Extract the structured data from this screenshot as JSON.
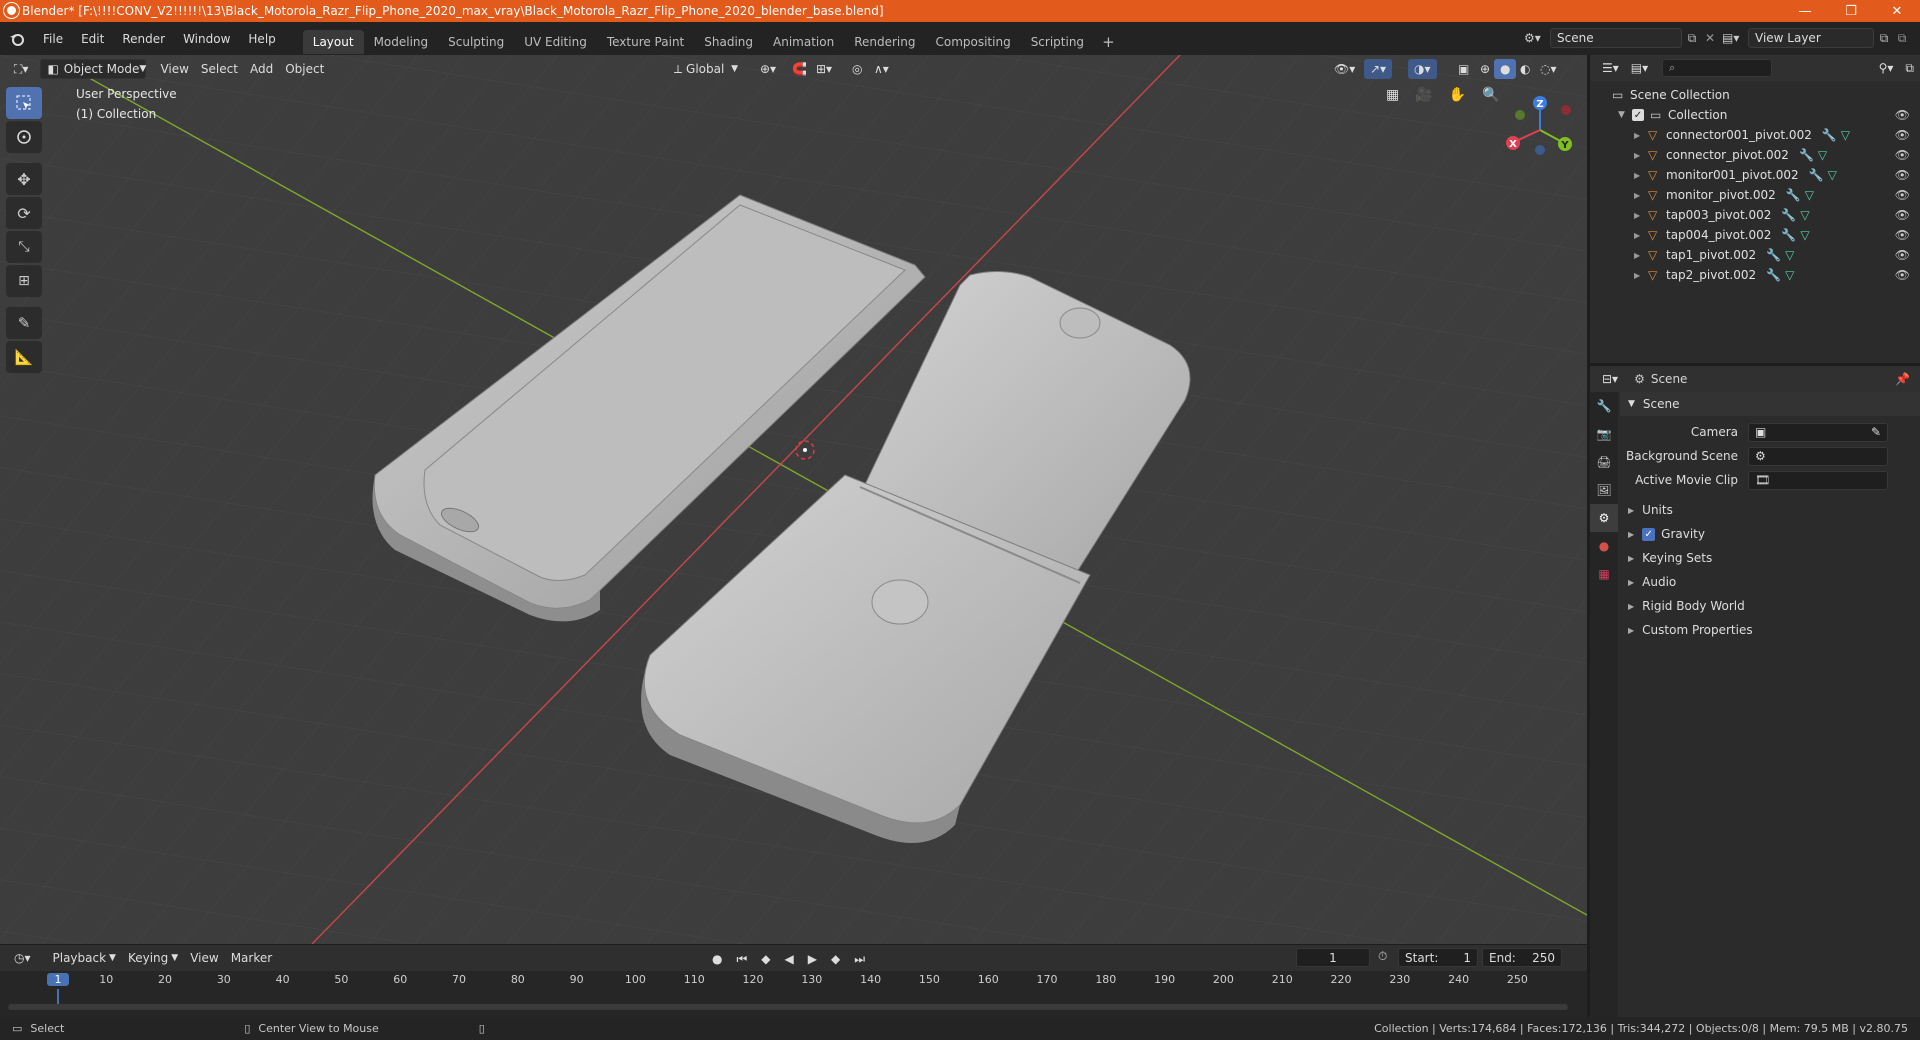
{
  "window": {
    "title": "Blender* [F:\\!!!!CONV_V2!!!!!!\\13\\Black_Motorola_Razr_Flip_Phone_2020_max_vray\\Black_Motorola_Razr_Flip_Phone_2020_blender_base.blend]",
    "minimize": "—",
    "maximize": "❐",
    "close": "✕"
  },
  "menu": {
    "items": [
      "File",
      "Edit",
      "Render",
      "Window",
      "Help"
    ],
    "workspaces": [
      "Layout",
      "Modeling",
      "Sculpting",
      "UV Editing",
      "Texture Paint",
      "Shading",
      "Animation",
      "Rendering",
      "Compositing",
      "Scripting"
    ],
    "active_workspace": "Layout",
    "add_tab": "+",
    "scene": "Scene",
    "view_layer": "View Layer"
  },
  "viewport": {
    "mode": "Object Mode",
    "menus": [
      "View",
      "Select",
      "Add",
      "Object"
    ],
    "orientation": "Global",
    "perspective_label": "User Perspective",
    "collection_label": "(1) Collection",
    "gizmo": {
      "x": "X",
      "y": "Y",
      "z": "Z"
    }
  },
  "outliner": {
    "search_placeholder": "",
    "root": "Scene Collection",
    "collection": "Collection",
    "objects": [
      "connector001_pivot.002",
      "connector_pivot.002",
      "monitor001_pivot.002",
      "monitor_pivot.002",
      "tap003_pivot.002",
      "tap004_pivot.002",
      "tap1_pivot.002",
      "tap2_pivot.002"
    ]
  },
  "properties": {
    "context": "Scene",
    "section": "Scene",
    "camera_label": "Camera",
    "background_scene_label": "Background Scene",
    "active_movie_clip_label": "Active Movie Clip",
    "panels": [
      "Units",
      "Gravity",
      "Keying Sets",
      "Audio",
      "Rigid Body World",
      "Custom Properties"
    ],
    "gravity_checked": true
  },
  "timeline": {
    "menus": [
      "Playback",
      "Keying",
      "View",
      "Marker"
    ],
    "current_frame": "1",
    "start_label": "Start:",
    "start": "1",
    "end_label": "End:",
    "end": "250",
    "ruler": [
      "1",
      "10",
      "20",
      "30",
      "40",
      "50",
      "60",
      "70",
      "80",
      "90",
      "100",
      "110",
      "120",
      "130",
      "140",
      "150",
      "160",
      "170",
      "180",
      "190",
      "200",
      "210",
      "220",
      "230",
      "240",
      "250"
    ]
  },
  "statusbar": {
    "select": "Select",
    "center_view": "Center View to Mouse",
    "stats": "Collection | Verts:174,684 | Faces:172,136 | Tris:344,272 | Objects:0/8 | Mem: 79.5 MB | v2.80.75"
  },
  "colors": {
    "title_bar": "#e25a1c",
    "viewport_bg": "#3d3d3d",
    "x_axis": "#c8474d",
    "y_axis": "#7fa82a",
    "accent": "#5072b0"
  }
}
